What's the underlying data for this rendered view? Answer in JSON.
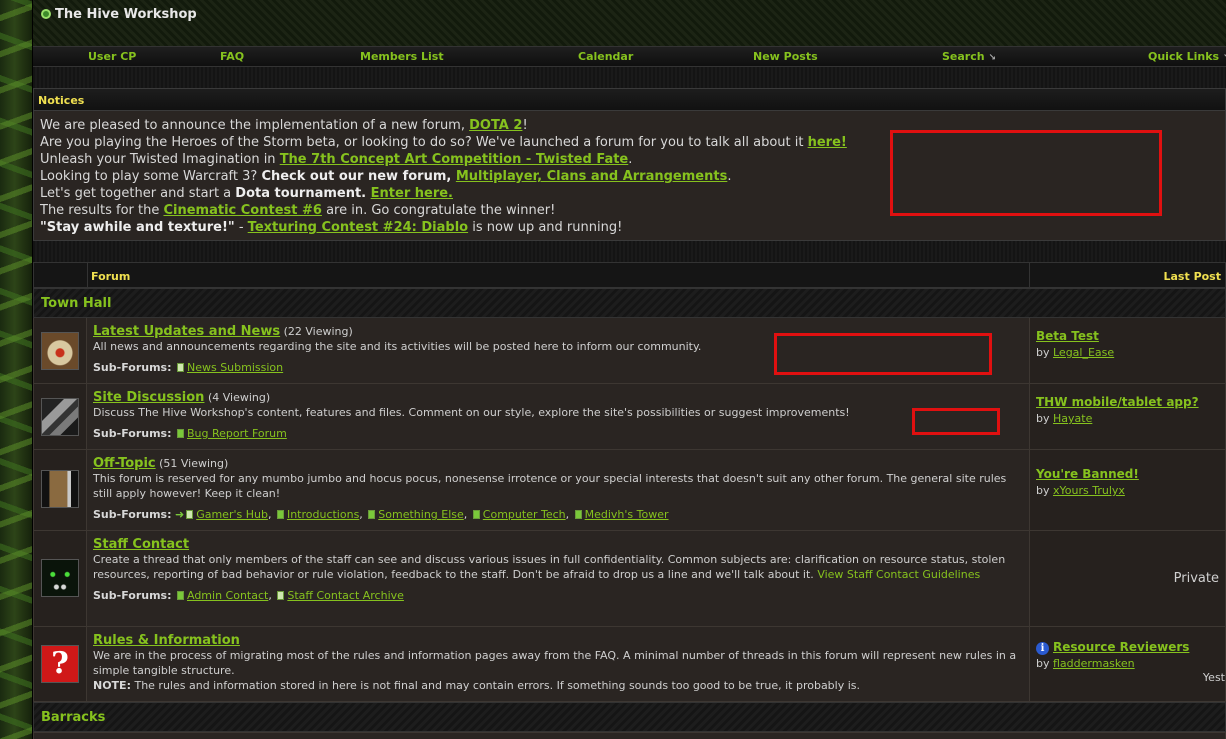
{
  "site": {
    "title": "The Hive Workshop"
  },
  "nav": [
    {
      "label": "User CP"
    },
    {
      "label": "FAQ"
    },
    {
      "label": "Members List"
    },
    {
      "label": "Calendar"
    },
    {
      "label": "New Posts"
    },
    {
      "label": "Search"
    },
    {
      "label": "Quick Links"
    }
  ],
  "notices": {
    "heading": "Notices",
    "lines": [
      {
        "pre": "We are pleased to announce the implementation of a new forum, ",
        "link": "DOTA 2",
        "post": "!"
      },
      {
        "pre": "Are you playing the Heroes of the Storm beta, or looking to do so? We've launched a forum for you to talk all about it ",
        "link": "here!",
        "post": ""
      },
      {
        "pre": "Unleash your Twisted Imagination in ",
        "link": "The 7th Concept Art Competition - Twisted Fate",
        "post": "."
      },
      {
        "pre": "Looking to play some Warcraft 3? ",
        "bold": "Check out our new forum, ",
        "link": "Multiplayer, Clans and Arrangements",
        "post": "."
      },
      {
        "pre": "Let's get together and start a ",
        "bold": "Dota tournament. ",
        "link": "Enter here.",
        "post": ""
      },
      {
        "pre": "The results for the ",
        "link": "Cinematic Contest #6",
        "post": " are in. Go congratulate the winner!"
      },
      {
        "bold": "\"Stay awhile and texture!\"",
        "pre": " - ",
        "link": "Texturing Contest #24: Diablo",
        "post": " is now up and running!"
      }
    ]
  },
  "table_head": {
    "forum": "Forum",
    "last_post": "Last Post"
  },
  "categories": {
    "town_hall": "Town Hall",
    "barracks": "Barracks"
  },
  "subforums_label": "Sub-Forums:",
  "forums": [
    {
      "title": "Latest Updates and News",
      "viewing": "(22 Viewing)",
      "desc": "All news and announcements regarding the site and its activities will be posted here to inform our community.",
      "subs": [
        "News Submission"
      ],
      "last_title": "Beta Test",
      "last_by": "by",
      "last_user": "Legal_Ease",
      "icon": "scroll-icon"
    },
    {
      "title": "Site Discussion",
      "viewing": "(4 Viewing)",
      "desc": "Discuss The Hive Workshop's content, features and files. Comment on our style, explore the site's possibilities or suggest improvements!",
      "subs": [
        "Bug Report Forum"
      ],
      "last_title": "THW mobile/tablet app?",
      "last_by": "by",
      "last_user": "Hayate",
      "icon": "hammer-icon"
    },
    {
      "title": "Off-Topic",
      "viewing": "(51 Viewing)",
      "desc": "This forum is reserved for any mumbo jumbo and hocus pocus, nonesense irrotence or your special interests that doesn't suit any other forum. The general site rules still apply however! Keep it clean!",
      "subs": [
        "Gamer's Hub",
        "Introductions",
        "Something Else",
        "Computer Tech",
        "Medivh's Tower"
      ],
      "last_title": "You're Banned!",
      "last_by": "by",
      "last_user": "xYours Trulyx",
      "icon": "tankard-icon"
    },
    {
      "title": "Staff Contact",
      "viewing": "",
      "desc": "Create a thread that only members of the staff can see and discuss various issues in full confidentiality. Common subjects are: clarification on resource status, stolen resources, reporting of bad behavior or rule violation, feedback to the staff. Don't be afraid to drop us a line and we'll talk about it.",
      "desc_link": "View Staff Contact Guidelines",
      "subs": [
        "Admin Contact",
        "Staff Contact Archive"
      ],
      "private": "Private",
      "icon": "eyes-icon"
    },
    {
      "title": "Rules & Information",
      "viewing": "",
      "desc": "We are in the process of migrating most of the rules and information pages away from the FAQ. A minimal number of threads in this forum will represent new rules in a simple tangible structure.",
      "note_label": "NOTE:",
      "note": " The rules and information stored in here is not final and may contain errors. If something sounds too good to be true, it probably is.",
      "last_title": "Resource Reviewers",
      "last_by": "by",
      "last_user": "fladdermasken",
      "trail": "Yest",
      "icon": "question-mark-icon"
    }
  ]
}
